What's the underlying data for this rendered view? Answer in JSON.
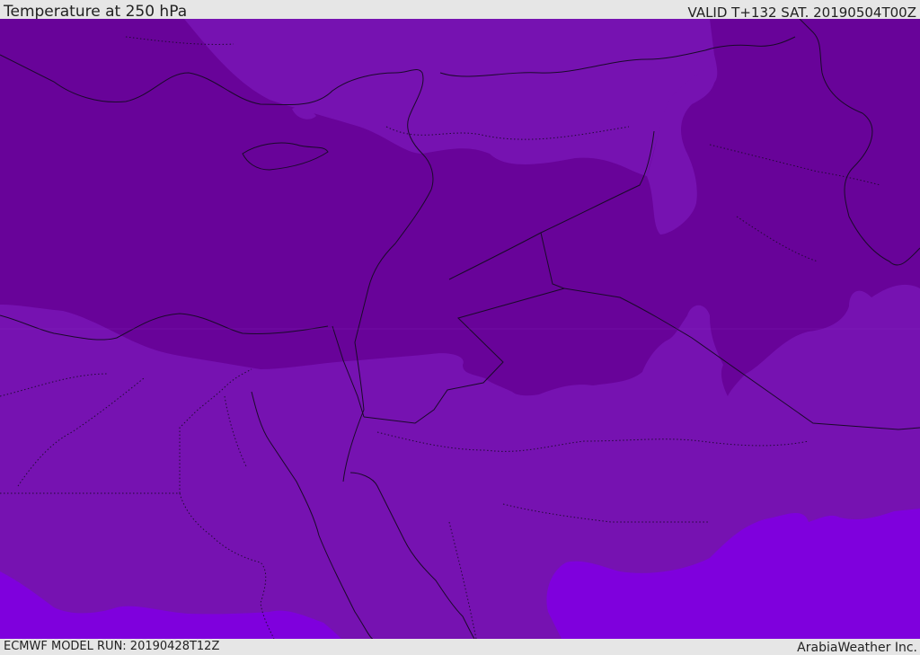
{
  "header": {
    "title": "Temperature at 250 hPa",
    "valid": "VALID T+132 SAT. 20190504T00Z"
  },
  "footer": {
    "model_run": "ECMWF MODEL RUN: 20190428T12Z",
    "credit": "ArabiaWeather Inc."
  },
  "colors": {
    "cold_band": "#680399",
    "mid_band": "#7612b1",
    "warm_band": "#7f00dd",
    "lines": "#1a0a2a"
  }
}
